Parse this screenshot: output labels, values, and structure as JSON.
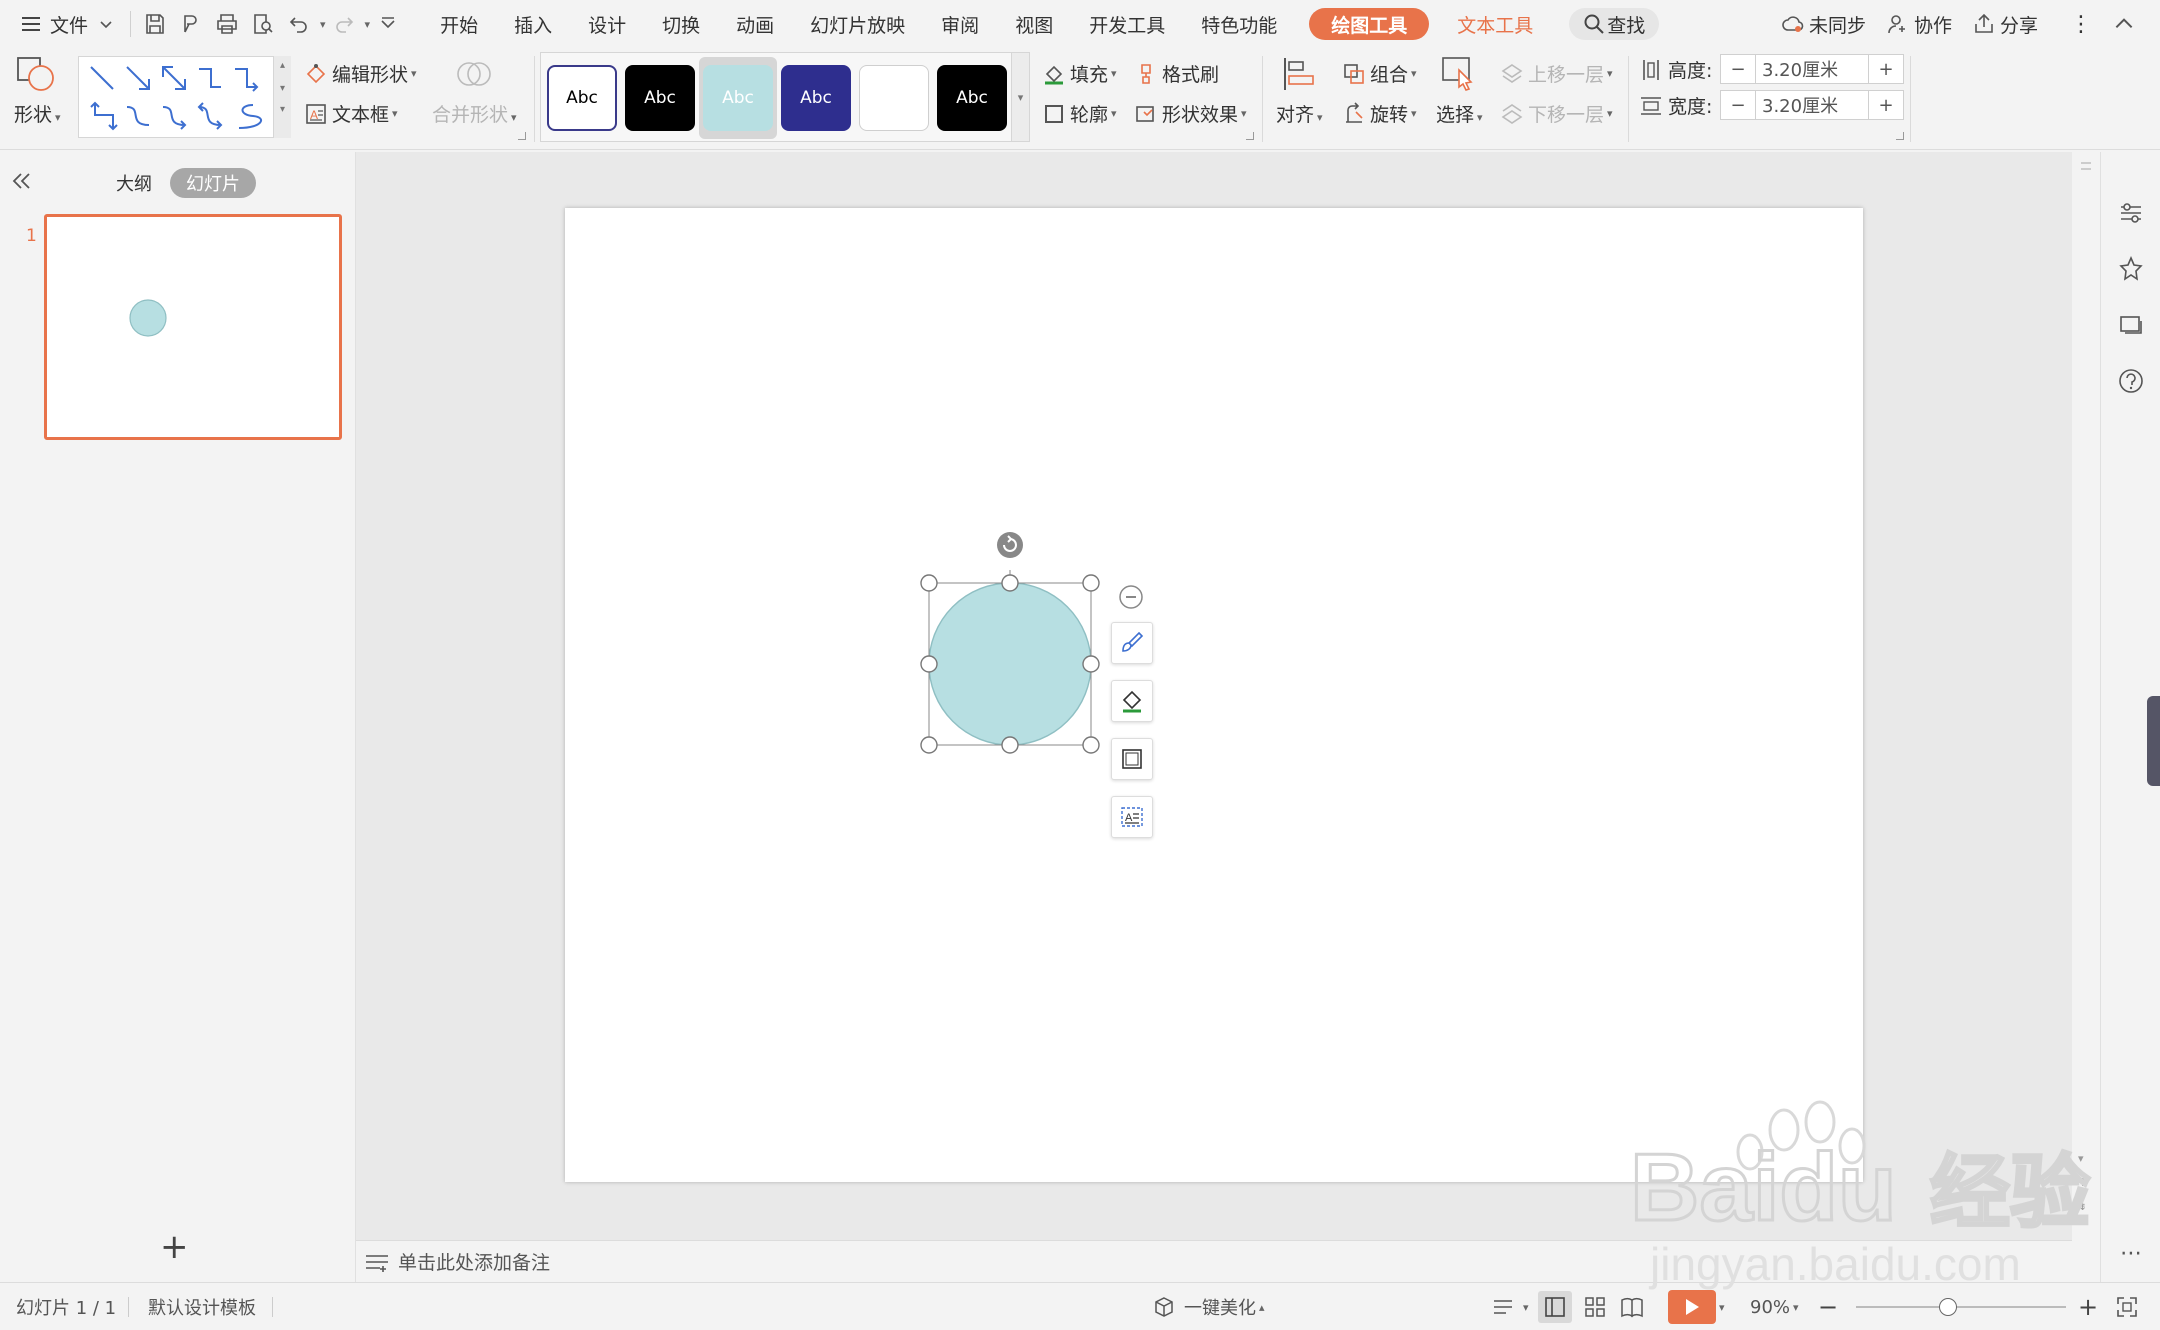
{
  "menu": {
    "file_label": "文件",
    "tabs": [
      "开始",
      "插入",
      "设计",
      "切换",
      "动画",
      "幻灯片放映",
      "审阅",
      "视图",
      "开发工具",
      "特色功能"
    ],
    "drawing_tools_label": "绘图工具",
    "text_tools_label": "文本工具",
    "search_label": "查找",
    "sync_label": "未同步",
    "collab_label": "协作",
    "share_label": "分享"
  },
  "ribbon": {
    "shape_label": "形状",
    "edit_shape_label": "编辑形状",
    "textbox_label": "文本框",
    "merge_shape_label": "合并形状",
    "style_boxes": [
      {
        "label": "Abc",
        "bg": "#ffffff",
        "fg": "#000000",
        "border": "#3a3a8a"
      },
      {
        "label": "Abc",
        "bg": "#000000",
        "fg": "#ffffff",
        "border": "#000000"
      },
      {
        "label": "Abc",
        "bg": "#b7dfe2",
        "fg": "#ffffff",
        "border": "#b7dfe2"
      },
      {
        "label": "Abc",
        "bg": "#2e2e8e",
        "fg": "#ffffff",
        "border": "#2e2e8e"
      },
      {
        "label": "",
        "bg": "#ffffff",
        "fg": "#000000",
        "border": "#cfcfcf"
      },
      {
        "label": "Abc",
        "bg": "#000000",
        "fg": "#ffffff",
        "border": "#000000"
      }
    ],
    "fill_label": "填充",
    "format_painter_label": "格式刷",
    "outline_label": "轮廓",
    "shape_effects_label": "形状效果",
    "align_label": "对齐",
    "group_label": "组合",
    "rotate_label": "旋转",
    "select_label": "选择",
    "bring_forward_label": "上移一层",
    "send_backward_label": "下移一层",
    "height_label": "高度:",
    "height_value": "3.20厘米",
    "width_label": "宽度:",
    "width_value": "3.20厘米"
  },
  "leftpane": {
    "outline_tab": "大纲",
    "slides_tab": "幻灯片",
    "slide_number": "1",
    "add_slide": "+"
  },
  "notes": {
    "placeholder": "单击此处添加备注"
  },
  "statusbar": {
    "slide_info": "幻灯片 1 / 1",
    "template": "默认设计模板",
    "beautify": "一键美化",
    "zoom": "90%",
    "zoom_level": 0.43
  },
  "slide": {
    "circle_fill": "#b7dfe2",
    "circle_stroke": "#8fbfc3"
  },
  "colors": {
    "accent": "#e8734a"
  },
  "watermark": {
    "brand": "Baidu",
    "cn": "经验",
    "url": "jingyan.baidu.com"
  }
}
